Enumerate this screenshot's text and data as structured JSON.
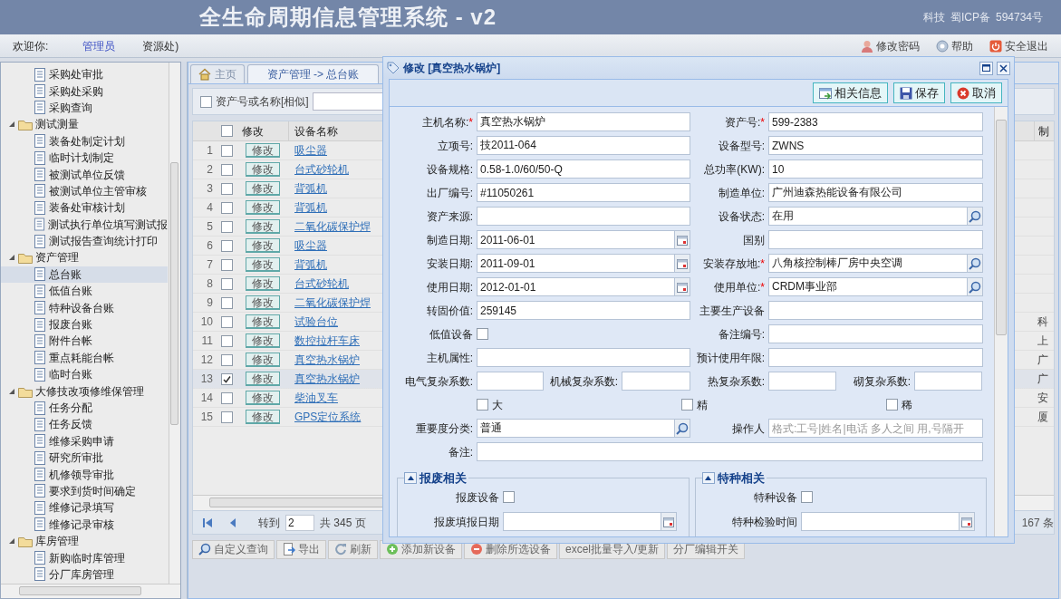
{
  "header": {
    "title": "全生命周期信息管理系统 - v2",
    "right_texts": [
      "科技",
      "蜀ICP备",
      "594734号"
    ]
  },
  "welcome": {
    "prefix": "欢迎你:",
    "user": "管理员",
    "dept": "资源处)",
    "links": [
      {
        "label": "修改密码"
      },
      {
        "label": "帮助"
      },
      {
        "label": "安全退出"
      }
    ]
  },
  "tree": [
    {
      "kind": "leaf",
      "label": "采购处审批",
      "selected": false
    },
    {
      "kind": "leaf",
      "label": "采购处采购",
      "selected": false
    },
    {
      "kind": "leaf",
      "label": "采购查询",
      "selected": false
    },
    {
      "kind": "folder",
      "label": "测试测量",
      "expanded": true,
      "selected": false,
      "children": [
        {
          "kind": "leaf",
          "label": "装备处制定计划",
          "selected": false
        },
        {
          "kind": "leaf",
          "label": "临时计划制定",
          "selected": false
        },
        {
          "kind": "leaf",
          "label": "被测试单位反馈",
          "selected": false
        },
        {
          "kind": "leaf",
          "label": "被测试单位主管审核",
          "selected": false
        },
        {
          "kind": "leaf",
          "label": "装备处审核计划",
          "selected": false
        },
        {
          "kind": "leaf",
          "label": "测试执行单位填写测试报",
          "selected": false
        },
        {
          "kind": "leaf",
          "label": "测试报告查询统计打印",
          "selected": false
        }
      ]
    },
    {
      "kind": "folder",
      "label": "资产管理",
      "expanded": true,
      "selected": false,
      "children": [
        {
          "kind": "leaf",
          "label": "总台账",
          "selected": true
        },
        {
          "kind": "leaf",
          "label": "低值台账",
          "selected": false
        },
        {
          "kind": "leaf",
          "label": "特种设备台账",
          "selected": false
        },
        {
          "kind": "leaf",
          "label": "报废台账",
          "selected": false
        },
        {
          "kind": "leaf",
          "label": "附件台帐",
          "selected": false
        },
        {
          "kind": "leaf",
          "label": "重点耗能台帐",
          "selected": false
        },
        {
          "kind": "leaf",
          "label": "临时台账",
          "selected": false
        }
      ]
    },
    {
      "kind": "folder",
      "label": "大修技改项修维保管理",
      "expanded": true,
      "selected": false,
      "children": [
        {
          "kind": "leaf",
          "label": "任务分配",
          "selected": false
        },
        {
          "kind": "leaf",
          "label": "任务反馈",
          "selected": false
        },
        {
          "kind": "leaf",
          "label": "维修采购申请",
          "selected": false
        },
        {
          "kind": "leaf",
          "label": "研究所审批",
          "selected": false
        },
        {
          "kind": "leaf",
          "label": "机修领导审批",
          "selected": false
        },
        {
          "kind": "leaf",
          "label": "要求到货时间确定",
          "selected": false
        },
        {
          "kind": "leaf",
          "label": "维修记录填写",
          "selected": false
        },
        {
          "kind": "leaf",
          "label": "维修记录审核",
          "selected": false
        }
      ]
    },
    {
      "kind": "folder",
      "label": "库房管理",
      "expanded": true,
      "selected": false,
      "children": [
        {
          "kind": "leaf",
          "label": "新购临时库管理",
          "selected": false
        },
        {
          "kind": "leaf",
          "label": "分厂库房管理",
          "selected": false
        }
      ]
    }
  ],
  "tabs": [
    {
      "kind": "home",
      "label": "主页",
      "selected": false
    },
    {
      "kind": "page",
      "label": "资产管理 -> 总台账",
      "selected": true
    }
  ],
  "search": {
    "label": "资产号或名称[相似]",
    "checked": false
  },
  "table": {
    "all_checked": false,
    "columns": [
      "修改",
      "设备名称",
      "制"
    ],
    "rows": [
      {
        "number": "1",
        "checked": false,
        "selected": false,
        "edit": "修改",
        "name": "吸尘器",
        "column_3": ""
      },
      {
        "number": "2",
        "checked": false,
        "selected": false,
        "edit": "修改",
        "name": "台式砂轮机",
        "column_3": ""
      },
      {
        "number": "3",
        "checked": false,
        "selected": false,
        "edit": "修改",
        "name": "背弧机",
        "column_3": ""
      },
      {
        "number": "4",
        "checked": false,
        "selected": false,
        "edit": "修改",
        "name": "背弧机",
        "column_3": ""
      },
      {
        "number": "5",
        "checked": false,
        "selected": false,
        "edit": "修改",
        "name": "二氧化碳保护焊",
        "column_3": ""
      },
      {
        "number": "6",
        "checked": false,
        "selected": false,
        "edit": "修改",
        "name": "吸尘器",
        "column_3": ""
      },
      {
        "number": "7",
        "checked": false,
        "selected": false,
        "edit": "修改",
        "name": "背弧机",
        "column_3": ""
      },
      {
        "number": "8",
        "checked": false,
        "selected": false,
        "edit": "修改",
        "name": "台式砂轮机",
        "column_3": ""
      },
      {
        "number": "9",
        "checked": false,
        "selected": false,
        "edit": "修改",
        "name": "二氧化碳保护焊",
        "column_3": ""
      },
      {
        "number": "10",
        "checked": false,
        "selected": false,
        "edit": "修改",
        "name": "试验台位",
        "column_3": "科"
      },
      {
        "number": "11",
        "checked": false,
        "selected": false,
        "edit": "修改",
        "name": "数控拉杆车床",
        "column_3": "上"
      },
      {
        "number": "12",
        "checked": false,
        "selected": false,
        "edit": "修改",
        "name": "真空热水锅炉",
        "column_3": "广"
      },
      {
        "number": "13",
        "checked": true,
        "selected": true,
        "edit": "修改",
        "name": "真空热水锅炉",
        "column_3": "广"
      },
      {
        "number": "14",
        "checked": false,
        "selected": false,
        "edit": "修改",
        "name": "柴油叉车",
        "column_3": "安"
      },
      {
        "number": "15",
        "checked": false,
        "selected": false,
        "edit": "修改",
        "name": "GPS定位系统",
        "column_3": "厦"
      }
    ]
  },
  "pager": {
    "goto_label": "转到",
    "page": "2",
    "total_pages": "共 345 页",
    "total_records": "167 条"
  },
  "toolbar": [
    {
      "label": "自定义查询"
    },
    {
      "label": "导出"
    },
    {
      "label": "刷新"
    },
    {
      "label": "添加新设备"
    },
    {
      "label": "删除所选设备"
    },
    {
      "label": "excel批量导入/更新"
    },
    {
      "label": "分厂编辑开关"
    }
  ],
  "dialog": {
    "title": "修改 [真空热水锅炉]",
    "buttons": [
      {
        "label": "相关信息"
      },
      {
        "label": "保存"
      },
      {
        "label": "取消"
      }
    ],
    "rows": [
      {
        "kind": "pair",
        "fields": [
          {
            "kind": "text",
            "label": "主机名称:",
            "mark": "*",
            "value": "真空热水锅炉"
          },
          {
            "kind": "text",
            "label": "资产号:",
            "mark": "*",
            "value": "599-2383"
          }
        ]
      },
      {
        "kind": "pair",
        "fields": [
          {
            "kind": "text",
            "label": "立项号:",
            "value": "技2011-064"
          },
          {
            "kind": "text",
            "label": "设备型号:",
            "value": "ZWNS"
          }
        ]
      },
      {
        "kind": "pair",
        "fields": [
          {
            "kind": "text",
            "label": "设备规格:",
            "value": "0.58-1.0/60/50-Q"
          },
          {
            "kind": "text",
            "label": "总功率(KW):",
            "value": "10"
          }
        ]
      },
      {
        "kind": "pair",
        "fields": [
          {
            "kind": "text",
            "label": "出厂编号:",
            "value": "#11050261"
          },
          {
            "kind": "text",
            "label": "制造单位:",
            "value": "广州迪森热能设备有限公司"
          }
        ]
      },
      {
        "kind": "pair",
        "fields": [
          {
            "kind": "text",
            "label": "资产来源:"
          },
          {
            "kind": "lookup",
            "label": "设备状态:",
            "value": "在用"
          }
        ]
      },
      {
        "kind": "pair",
        "fields": [
          {
            "kind": "date",
            "label": "制造日期:",
            "value": "2011-06-01"
          },
          {
            "kind": "text",
            "label": "国别"
          }
        ]
      },
      {
        "kind": "pair",
        "fields": [
          {
            "kind": "date",
            "label": "安装日期:",
            "value": "2011-09-01"
          },
          {
            "kind": "lookup",
            "label": "安装存放地:",
            "mark": "*",
            "value": "八角核控制棒厂房中央空调"
          }
        ]
      },
      {
        "kind": "pair",
        "fields": [
          {
            "kind": "date",
            "label": "使用日期:",
            "value": "2012-01-01"
          },
          {
            "kind": "lookup",
            "label": "使用单位:",
            "mark": "*",
            "value": "CRDM事业部"
          }
        ]
      },
      {
        "kind": "pair",
        "fields": [
          {
            "kind": "text",
            "label": "转固价值:",
            "value": "259145"
          },
          {
            "kind": "text",
            "label": "主要生产设备"
          }
        ]
      },
      {
        "kind": "pair",
        "fields": [
          {
            "kind": "checkbox",
            "label": "低值设备",
            "checked": false
          },
          {
            "kind": "text",
            "label": "备注编号:"
          }
        ]
      },
      {
        "kind": "pair",
        "fields": [
          {
            "kind": "text",
            "label": "主机属性:"
          },
          {
            "kind": "text",
            "label": "预计使用年限:"
          }
        ]
      },
      {
        "kind": "quad",
        "fields": [
          {
            "kind": "text",
            "label": "电气复杂系数:"
          },
          {
            "kind": "text",
            "label": "机械复杂系数:"
          },
          {
            "kind": "text",
            "label": "热复杂系数:"
          },
          {
            "kind": "text",
            "label": "砌复杂系数:"
          }
        ]
      },
      {
        "kind": "checks",
        "fields": [
          {
            "label": "大",
            "checked": false
          },
          {
            "label": "精",
            "checked": false
          },
          {
            "label": "稀",
            "checked": false
          }
        ]
      },
      {
        "kind": "pair",
        "fields": [
          {
            "kind": "lookup",
            "label": "重要度分类:",
            "value": "普通"
          },
          {
            "kind": "text",
            "label": "操作人",
            "placeholder": "格式:工号|姓名|电话 多人之间 用,号隔开"
          }
        ]
      },
      {
        "kind": "wide",
        "fields": [
          {
            "kind": "text",
            "label": "备注:"
          }
        ]
      }
    ],
    "sections": [
      {
        "title": "报废相关",
        "fields": [
          {
            "kind": "checkbox",
            "label": "报废设备",
            "checked": false
          },
          {
            "kind": "date",
            "label": "报废填报日期"
          }
        ]
      },
      {
        "title": "特种相关",
        "fields": [
          {
            "kind": "checkbox",
            "label": "特种设备",
            "checked": false
          },
          {
            "kind": "date",
            "label": "特种检验时间"
          }
        ]
      }
    ]
  }
}
